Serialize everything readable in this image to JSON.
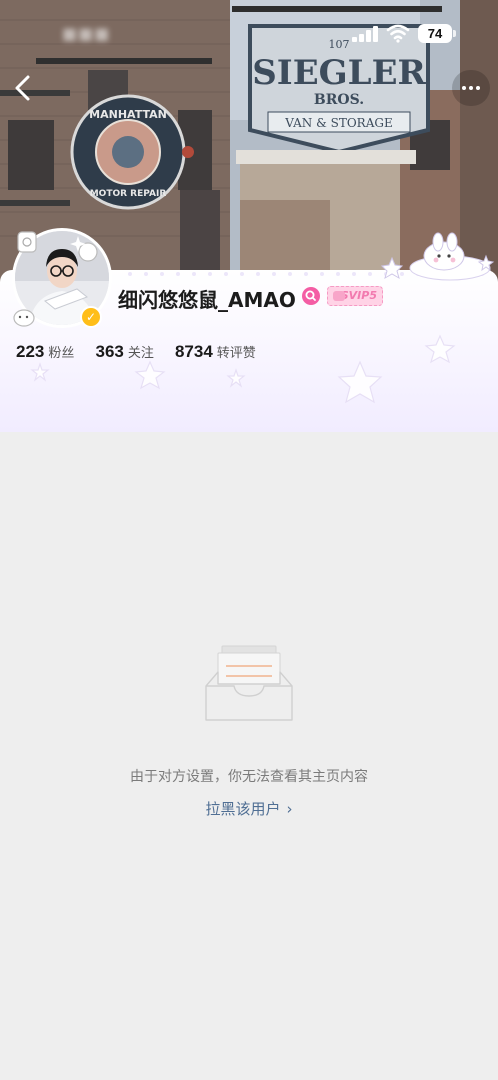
{
  "status_bar": {
    "battery_level": "74",
    "icons": [
      "signal-icon",
      "wifi-icon",
      "battery-icon"
    ]
  },
  "nav": {
    "back_icon": "chevron-left-icon",
    "more_icon": "ellipsis-icon"
  },
  "cover": {
    "sign_left": [
      "MANHATTAN",
      "MOTOR REPAIR"
    ],
    "sign_right": [
      "107",
      "SIEGLER",
      "BROS.",
      "VAN & STORAGE"
    ]
  },
  "profile": {
    "username": "细闪悠悠鼠_AMAO",
    "verified_icon": "verified-badge-icon",
    "vip_label": "SVIP5",
    "stats": [
      {
        "value": "223",
        "label": "粉丝"
      },
      {
        "value": "363",
        "label": "关注"
      },
      {
        "value": "8734",
        "label": "转评赞"
      }
    ]
  },
  "empty_state": {
    "icon": "empty-inbox-icon",
    "message": "由于对方设置，你无法查看其主页内容",
    "block_link": "拉黑该用户"
  },
  "colors": {
    "page_bg": "#eeeeee",
    "link": "#506f94",
    "verified": "#ffbe19",
    "vip_pink": "#f27aaf"
  }
}
